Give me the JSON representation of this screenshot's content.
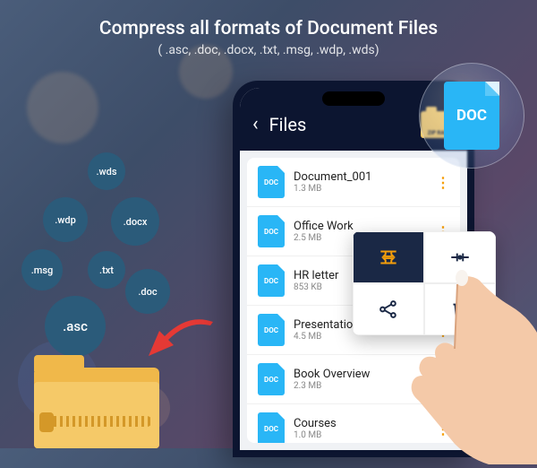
{
  "headline": {
    "title": "Compress all formats of Document Files",
    "subtitle": "( .asc, .doc, .docx, .txt, .msg, .wdp, .wds)"
  },
  "bubbles": {
    "wds": ".wds",
    "wdp": ".wdp",
    "docx": ".docx",
    "msg": ".msg",
    "txt": ".txt",
    "doc": ".doc",
    "asc": ".asc"
  },
  "big_doc_label": "DOC",
  "phone": {
    "header_title": "Files",
    "zip_badge": "ZIP RAR",
    "file_icon_label": "DOC",
    "files": [
      {
        "name": "Document_001",
        "size": "1.3 MB"
      },
      {
        "name": "Office Work",
        "size": "2.5 MB"
      },
      {
        "name": "HR letter",
        "size": "853 KB"
      },
      {
        "name": "Presentation de",
        "size": "4.5 MB"
      },
      {
        "name": "Book Overview",
        "size": "2.3 MB"
      },
      {
        "name": "Courses",
        "size": "1.0 MB"
      }
    ]
  },
  "ctx_icons": {
    "compress": "compress-icon",
    "extract": "extract-icon",
    "share": "share-icon",
    "delete": "delete-icon"
  },
  "colors": {
    "accent": "#29b6f6",
    "menu_active_bg": "#1a2845",
    "menu_active_icon": "#f59e0b"
  }
}
